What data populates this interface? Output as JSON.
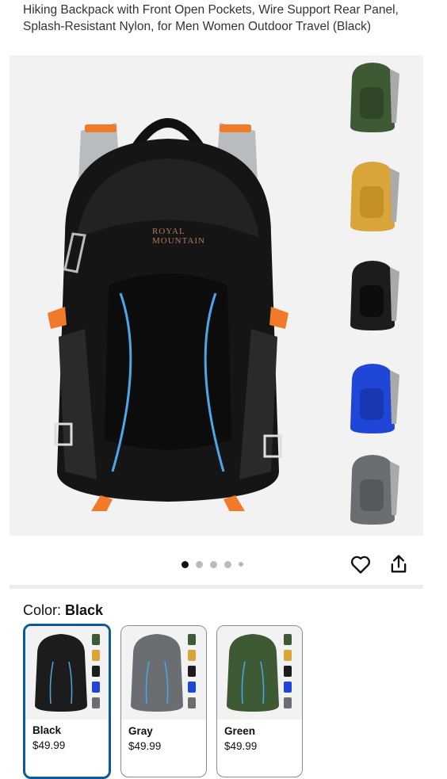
{
  "product": {
    "title": "Hiking Backpack with Front Open Pockets, Wire Support Rear Panel, Splash-Resistant Nylon, for Men Women Outdoor Travel (Black)",
    "brand_logo_text_line1": "ROYAL",
    "brand_logo_text_line2": "MOUNTAIN"
  },
  "gallery": {
    "dots": 5,
    "active_dot": 0,
    "thumbnails": [
      {
        "color_name": "green",
        "body": "#3e5a34"
      },
      {
        "color_name": "yellow",
        "body": "#d9a43a"
      },
      {
        "color_name": "black",
        "body": "#1c1c1c"
      },
      {
        "color_name": "blue",
        "body": "#1f46d6"
      },
      {
        "color_name": "gray",
        "body": "#6a6d72"
      }
    ]
  },
  "icons": {
    "favorite": "heart-icon",
    "share": "share-icon"
  },
  "color_selector": {
    "label": "Color:",
    "selected": "Black",
    "options": [
      {
        "name": "Black",
        "price": "$49.99",
        "body": "#1c1c1c"
      },
      {
        "name": "Gray",
        "price": "$49.99",
        "body": "#6a6d72"
      },
      {
        "name": "Green",
        "price": "$49.99",
        "body": "#3e5a34"
      }
    ]
  },
  "colors": {
    "selected_border": "#0b5b9a",
    "accent_strap": "#f07a2a",
    "accent_line": "#4aa8e8"
  }
}
